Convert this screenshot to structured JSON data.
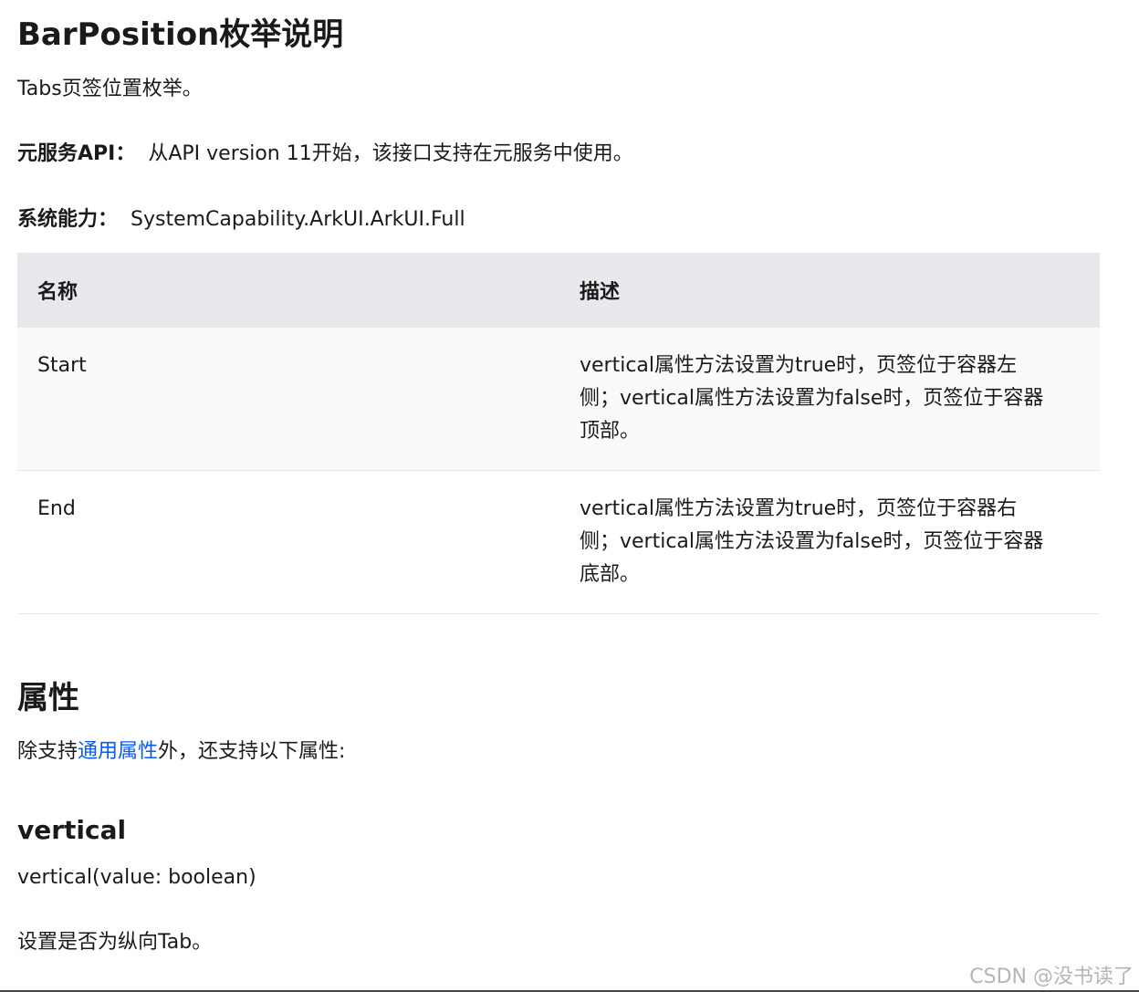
{
  "enum_section": {
    "title": "BarPosition枚举说明",
    "intro": "Tabs页签位置枚举。",
    "atomic_label": "元服务API：",
    "atomic_text": "从API version 11开始，该接口支持在元服务中使用。",
    "syscap_label": "系统能力：",
    "syscap_text": "SystemCapability.ArkUI.ArkUI.Full"
  },
  "table": {
    "headers": [
      "名称",
      "描述"
    ],
    "rows": [
      {
        "name": "Start",
        "desc_lines": [
          "vertical属性方法设置为true时，页签位于容器左",
          "侧；vertical属性方法设置为false时，页签位于容器",
          "顶部。"
        ]
      },
      {
        "name": "End",
        "desc_lines": [
          "vertical属性方法设置为true时，页签位于容器右",
          "侧；vertical属性方法设置为false时，页签位于容器",
          "底部。"
        ]
      }
    ]
  },
  "attributes": {
    "title": "属性",
    "intro_before": "除支持",
    "intro_link": "通用属性",
    "intro_after": "外，还支持以下属性:",
    "link_color": "#0a59f7"
  },
  "vertical": {
    "title": "vertical",
    "signature": "vertical(value: boolean)",
    "description": "设置是否为纵向Tab。"
  },
  "watermark": "CSDN @没书读了"
}
